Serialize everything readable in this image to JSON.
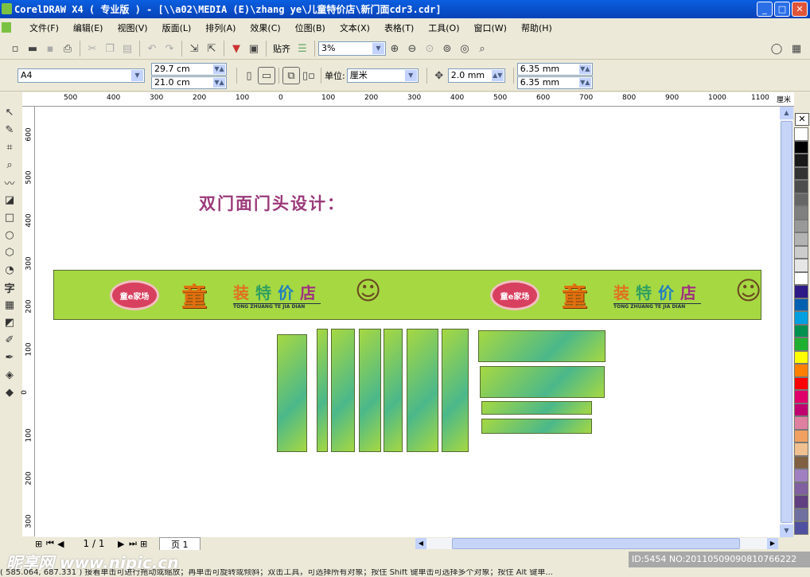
{
  "window": {
    "title": "CorelDRAW X4 ( 专业版 ) - [\\\\a02\\MEDIA (E)\\zhang  ye\\儿童特价店\\新门面cdr3.cdr]",
    "minimize": "_",
    "maximize": "□",
    "close": "✕"
  },
  "menu": [
    "文件(F)",
    "编辑(E)",
    "视图(V)",
    "版面(L)",
    "排列(A)",
    "效果(C)",
    "位图(B)",
    "文本(X)",
    "表格(T)",
    "工具(O)",
    "窗口(W)",
    "帮助(H)"
  ],
  "toolbar": {
    "snap_label": "贴齐",
    "zoom_value": "3%"
  },
  "property_bar": {
    "paper_size": "A4",
    "width": "29.7 cm",
    "height": "21.0 cm",
    "unit_label": "单位:",
    "unit_value": "厘米",
    "nudge": "2.0 mm",
    "dup_x": "6.35 mm",
    "dup_y": "6.35 mm"
  },
  "ruler": {
    "unit": "厘米",
    "h_labels": [
      "500",
      "400",
      "300",
      "200",
      "100",
      "0",
      "100",
      "200",
      "300",
      "400",
      "500",
      "600",
      "700",
      "800",
      "900",
      "1000",
      "1100"
    ],
    "v_labels": [
      "600",
      "500",
      "400",
      "300",
      "200",
      "100",
      "0",
      "100",
      "200",
      "300"
    ]
  },
  "canvas": {
    "heading": "双门面门头设计：",
    "banner_logo": "童e家场",
    "banner_char": "童",
    "banner_text": [
      "装",
      "特",
      "价",
      "店"
    ],
    "banner_pinyin": "TONG ZHUANG TE JIA DIAN",
    "heading_color": "#9b3a7a",
    "banner_color": "#a6d842"
  },
  "page_nav": {
    "count": "1 / 1",
    "tab": "页 1"
  },
  "palette": [
    "#ffffff",
    "#000000",
    "#1a1a1a",
    "#333333",
    "#4d4d4d",
    "#666666",
    "#808080",
    "#999999",
    "#b3b3b3",
    "#cccccc",
    "#e6e6e6",
    "#ffffff",
    "#2e1a87",
    "#0060b0",
    "#00a0e0",
    "#009050",
    "#20b030",
    "#ffff00",
    "#ff8000",
    "#ff0000",
    "#e0006a",
    "#c0006f",
    "#e080a0",
    "#f0a060",
    "#f0c090",
    "#806040",
    "#a080c0",
    "#8060a0",
    "#604080",
    "#7070a0",
    "#5050a0"
  ],
  "status": {
    "text": "( 585.064, 687.331 ) 接着单击可进行拖动或缩放；再单击可旋转或倾斜；双击工具，可选择所有对象；按住 Shift 键单击可选择多个对象；按住 Alt 键单...",
    "watermark": "昵享网 www.nipic.cn",
    "image_id": "ID:5454 NO:20110509090810766222"
  }
}
